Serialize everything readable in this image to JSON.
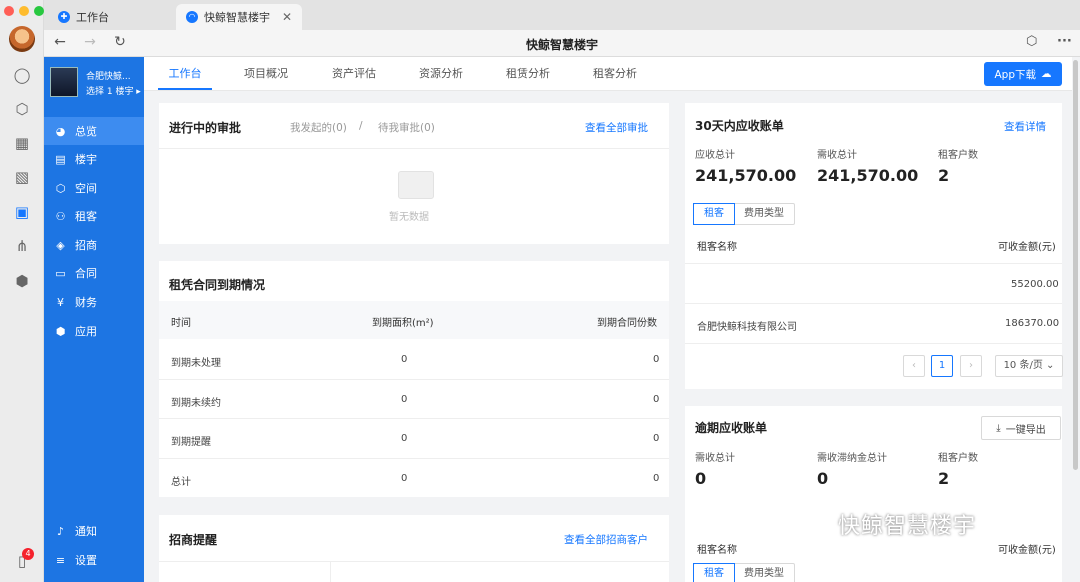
{
  "browser": {
    "tabs": [
      {
        "label": "工作台"
      },
      {
        "label": "快鲸智慧楼宇"
      }
    ],
    "window_title": "快鲸智慧楼宇"
  },
  "sidebar": {
    "building_name": "合肥快鲸...",
    "building_select": "选择 1 楼宇 ▸",
    "items": [
      {
        "label": "总览"
      },
      {
        "label": "楼宇"
      },
      {
        "label": "空间"
      },
      {
        "label": "租客"
      },
      {
        "label": "招商"
      },
      {
        "label": "合同"
      },
      {
        "label": "财务"
      },
      {
        "label": "应用"
      }
    ],
    "bottom": [
      {
        "label": "通知"
      },
      {
        "label": "设置"
      }
    ]
  },
  "dock": {
    "badge": "4"
  },
  "main_tabs": [
    "工作台",
    "项目概况",
    "资产评估",
    "资源分析",
    "租赁分析",
    "租客分析"
  ],
  "app_download": "App下载",
  "approvals": {
    "title": "进行中的审批",
    "mine": "我发起的(0)",
    "sep": "/",
    "pending": "待我审批(0)",
    "view_all": "查看全部审批",
    "empty": "暂无数据"
  },
  "expiry": {
    "title": "租凭合同到期情况",
    "headers": [
      "时间",
      "到期面积(m²)",
      "到期合同份数"
    ],
    "rows": [
      [
        "到期未处理",
        "0",
        "0"
      ],
      [
        "到期未续约",
        "0",
        "0"
      ],
      [
        "到期提醒",
        "0",
        "0"
      ],
      [
        "总计",
        "0",
        "0"
      ]
    ]
  },
  "leads": {
    "title": "招商提醒",
    "view_all": "查看全部招商客户"
  },
  "receivable": {
    "title": "30天内应收账单",
    "view_detail": "查看详情",
    "stats": [
      {
        "label": "应收总计",
        "value": "241,570.00"
      },
      {
        "label": "需收总计",
        "value": "241,570.00"
      },
      {
        "label": "租客户数",
        "value": "2"
      }
    ],
    "seg": [
      "租客",
      "费用类型"
    ],
    "headers": [
      "租客名称",
      "可收金额(元)"
    ],
    "rows": [
      [
        "",
        "55200.00"
      ],
      [
        "合肥快鲸科技有限公司",
        "186370.00"
      ]
    ],
    "page": "1",
    "page_size": "10 条/页"
  },
  "overdue": {
    "title": "逾期应收账单",
    "export": "一键导出",
    "stats": [
      {
        "label": "需收总计",
        "value": "0"
      },
      {
        "label": "需收滞纳金总计",
        "value": "0"
      },
      {
        "label": "租客户数",
        "value": "2"
      }
    ],
    "seg": [
      "租客",
      "费用类型"
    ],
    "headers": [
      "租客名称",
      "可收金额(元)"
    ]
  },
  "watermark_text": "快鲸智慧楼宇",
  "colors": {
    "accent": "#1677ff",
    "sidebar": "#1d75e3"
  }
}
